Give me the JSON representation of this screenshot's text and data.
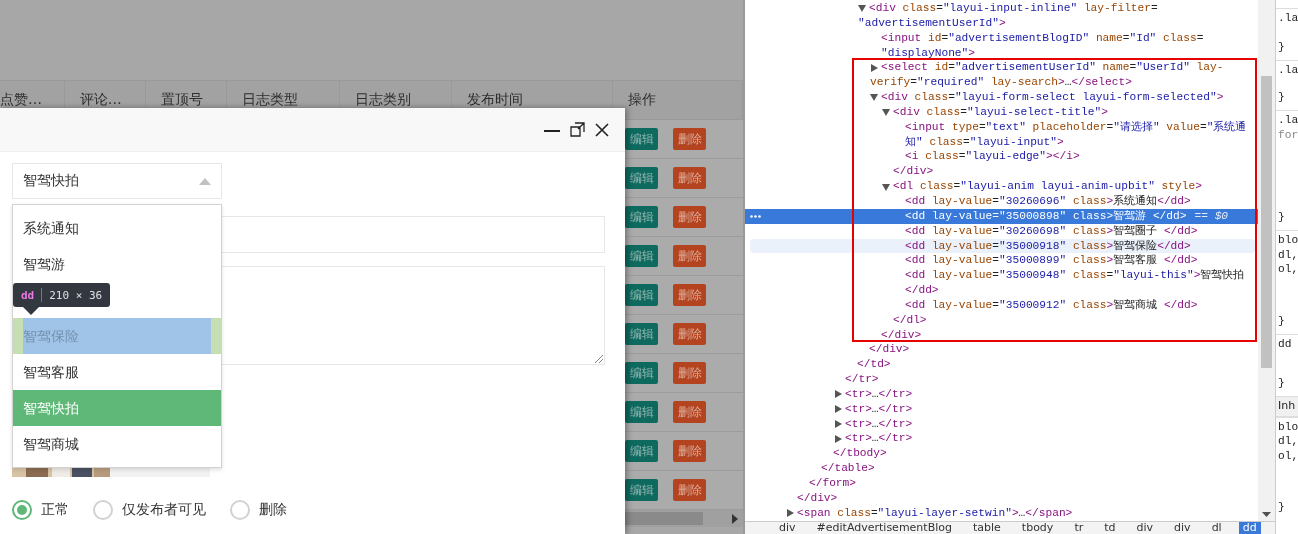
{
  "table": {
    "columns": [
      "点赞…",
      "评论…",
      "置顶号",
      "日志类型",
      "日志类别",
      "发布时间",
      "操作"
    ],
    "rows": [
      {
        "edit": "编辑",
        "delete": "删除"
      },
      {
        "edit": "编辑",
        "delete": "删除"
      },
      {
        "edit": "编辑",
        "delete": "删除"
      },
      {
        "edit": "编辑",
        "delete": "删除"
      },
      {
        "edit": "编辑",
        "delete": "删除"
      },
      {
        "edit": "编辑",
        "delete": "删除"
      },
      {
        "edit": "编辑",
        "delete": "删除"
      },
      {
        "edit": "编辑",
        "delete": "删除"
      },
      {
        "edit": "编辑",
        "delete": "删除"
      },
      {
        "edit": "编辑",
        "delete": "删除"
      }
    ]
  },
  "dialog": {
    "select": {
      "value": "智驾快拍",
      "expanded": true
    },
    "options": [
      {
        "label": "系统通知",
        "selected": false,
        "inspected": false
      },
      {
        "label": "智驾游",
        "selected": false,
        "inspected": false
      },
      {
        "label": "智驾保险",
        "selected": false,
        "inspected": true
      },
      {
        "label": "智驾客服",
        "selected": false,
        "inspected": false
      },
      {
        "label": "智驾快拍",
        "selected": true,
        "inspected": false
      },
      {
        "label": "智驾商城",
        "selected": false,
        "inspected": false
      }
    ],
    "inspector_tooltip": {
      "tag": "dd",
      "size": "210 × 36"
    },
    "radios": [
      {
        "label": "正常",
        "selected": true
      },
      {
        "label": "仅发布者可见",
        "selected": false
      },
      {
        "label": "删除",
        "selected": false
      }
    ]
  },
  "elements": {
    "tree": [
      {
        "close": "</div>",
        "children": [
          {
            "close": "</form>",
            "children": [
              {
                "close": "</table>",
                "children": [
                  {
                    "close": "</tbody>",
                    "children": [
                      {
                        "close": "</tr>",
                        "children": [
                          {
                            "close": "</td>",
                            "children": [
                              {
                                "lines": [
                                  "<div class=\"layui-input-inline\" lay-filter=",
                                  "\"advertisementUserId\">"
                                ],
                                "expanded": true,
                                "selected": false,
                                "hovered": false,
                                "close": "</div>",
                                "children": [
                                  {
                                    "lines": [
                                      "<input id=\"advertisementBlogID\" name=\"Id\" class=",
                                      "\"displayNone\">"
                                    ],
                                    "selected": false,
                                    "hovered": false
                                  },
                                  {
                                    "lines": [
                                      "<select id=\"advertisementUserId\" name=\"UserId\" lay-",
                                      "verify=\"required\" lay-search>…</select>"
                                    ],
                                    "expanded": false,
                                    "selected": false,
                                    "hovered": false
                                  },
                                  {
                                    "lines": [
                                      "<div class=\"layui-form-select layui-form-selected\">"
                                    ],
                                    "expanded": true,
                                    "selected": false,
                                    "hovered": false,
                                    "close": "</div>",
                                    "children": [
                                      {
                                        "lines": [
                                          "<div class=\"layui-select-title\">"
                                        ],
                                        "expanded": true,
                                        "selected": false,
                                        "hovered": false,
                                        "close": "</div>",
                                        "children": [
                                          {
                                            "lines": [
                                              "<input type=\"text\" placeholder=\"请选择\" value=\"系统通",
                                              "知\" class=\"layui-input\">"
                                            ],
                                            "selected": false,
                                            "hovered": false
                                          },
                                          {
                                            "lines": [
                                              "<i class=\"layui-edge\"></i>"
                                            ],
                                            "selected": false,
                                            "hovered": false
                                          }
                                        ]
                                      },
                                      {
                                        "lines": [
                                          "<dl class=\"layui-anim layui-anim-upbit\" style>"
                                        ],
                                        "expanded": true,
                                        "selected": false,
                                        "hovered": false,
                                        "close": "</dl>",
                                        "children": [
                                          {
                                            "lines": [
                                              "<dd lay-value=\"30260696\" class>系统通知</dd>"
                                            ],
                                            "selected": false,
                                            "hovered": false
                                          },
                                          {
                                            "lines": [
                                              "<dd lay-value=\"35000898\" class>智驾游 </dd>"
                                            ],
                                            "selected": true,
                                            "hovered": false,
                                            "suffix": "== $0"
                                          },
                                          {
                                            "lines": [
                                              "<dd lay-value=\"30260698\" class>智驾圈子 </dd>"
                                            ],
                                            "selected": false,
                                            "hovered": false
                                          },
                                          {
                                            "lines": [
                                              "<dd lay-value=\"35000918\" class>智驾保险</dd>"
                                            ],
                                            "selected": false,
                                            "hovered": true
                                          },
                                          {
                                            "lines": [
                                              "<dd lay-value=\"35000899\" class>智驾客服 </dd>"
                                            ],
                                            "selected": false,
                                            "hovered": false
                                          },
                                          {
                                            "lines": [
                                              "<dd lay-value=\"35000948\" class=\"layui-this\">智驾快拍",
                                              "</dd>"
                                            ],
                                            "selected": false,
                                            "hovered": false
                                          },
                                          {
                                            "lines": [
                                              "<dd lay-value=\"35000912\" class>智驾商城 </dd>"
                                            ],
                                            "selected": false,
                                            "hovered": false
                                          }
                                        ]
                                      }
                                    ]
                                  }
                                ]
                              }
                            ]
                          }
                        ]
                      },
                      {
                        "lines": [
                          "<tr>…</tr>"
                        ],
                        "expanded": false,
                        "selected": false,
                        "hovered": false
                      },
                      {
                        "lines": [
                          "<tr>…</tr>"
                        ],
                        "expanded": false,
                        "selected": false,
                        "hovered": false
                      },
                      {
                        "lines": [
                          "<tr>…</tr>"
                        ],
                        "expanded": false,
                        "selected": false,
                        "hovered": false
                      },
                      {
                        "lines": [
                          "<tr>…</tr>"
                        ],
                        "expanded": false,
                        "selected": false,
                        "hovered": false
                      }
                    ]
                  }
                ]
              }
            ]
          }
        ]
      },
      {
        "lines": [
          "<span class=\"layui-layer-setwin\">…</span>"
        ],
        "expanded": false,
        "selected": false,
        "hovered": false
      }
    ],
    "breadcrumbs": [
      {
        "label": "div",
        "selected": false
      },
      {
        "label": "#editAdvertisementBlog",
        "selected": false
      },
      {
        "label": "table",
        "selected": false
      },
      {
        "label": "tbody",
        "selected": false
      },
      {
        "label": "tr",
        "selected": false
      },
      {
        "label": "td",
        "selected": false
      },
      {
        "label": "div",
        "selected": false
      },
      {
        "label": "div",
        "selected": false
      },
      {
        "label": "dl",
        "selected": false
      },
      {
        "label": "dd",
        "selected": true
      }
    ]
  },
  "styles": {
    "blocks": [
      {
        "kind": "rule",
        "lines": [
          ".la",
          "}"
        ]
      },
      {
        "kind": "rule",
        "lines": [
          ".la",
          "}"
        ]
      },
      {
        "kind": "rule",
        "lines": [
          ".la",
          "for",
          "}"
        ]
      },
      {
        "kind": "rule",
        "lines": [
          "blo",
          "dl,",
          "ol,",
          "}"
        ]
      },
      {
        "kind": "rule",
        "lines": [
          "dd",
          "}"
        ]
      },
      {
        "kind": "header",
        "lines": [
          "Inh"
        ]
      },
      {
        "kind": "rule",
        "lines": [
          "blo",
          "dl,",
          "ol,",
          "}"
        ]
      }
    ]
  }
}
